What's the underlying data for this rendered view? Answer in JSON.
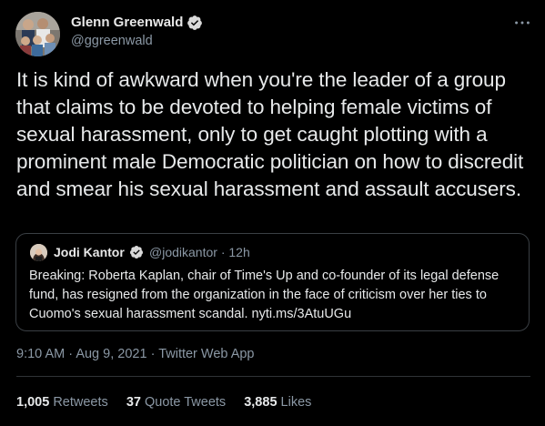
{
  "author": {
    "name": "Glenn Greenwald",
    "handle": "@ggreenwald",
    "avatar_icon": "avatar-photo",
    "verified_icon": "verified-badge-icon"
  },
  "tweet": {
    "text": "It is kind of awkward when you're the leader of a group that claims to be devoted to helping female victims of sexual harassment, only to get caught plotting with a prominent male Democratic politician on how to discredit and smear his sexual harassment and assault accusers."
  },
  "quoted_tweet": {
    "name": "Jodi Kantor",
    "handle": "@jodikantor",
    "separator": "·",
    "age": "12h",
    "text": "Breaking: Roberta Kaplan, chair of Time's Up and co-founder of its legal defense fund, has resigned from the organization in the face of criticism over her ties to Cuomo's sexual harassment scandal. nyti.ms/3AtuUGu"
  },
  "meta": {
    "time": "9:10 AM",
    "separator": "·",
    "date": "Aug 9, 2021",
    "source": "Twitter Web App"
  },
  "stats": {
    "retweets_count": "1,005",
    "retweets_label": "Retweets",
    "quotes_count": "37",
    "quotes_label": "Quote Tweets",
    "likes_count": "3,885",
    "likes_label": "Likes"
  },
  "colors": {
    "background": "#000000",
    "verified": "#d9d9d9",
    "secondary_text": "#8b98a5",
    "border": "#2f3336"
  }
}
